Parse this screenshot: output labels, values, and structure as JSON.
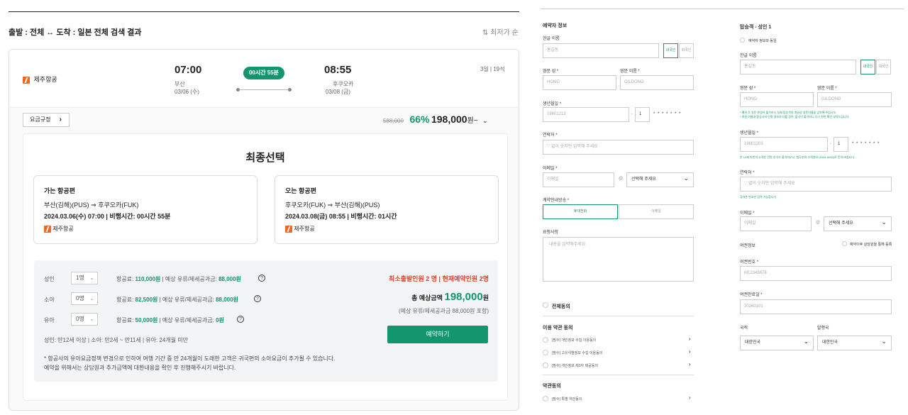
{
  "header": {
    "title": "출발 : 전체 ↔ 도착 : 일본 전체 검색 결과",
    "sort_label": "최저가 순"
  },
  "flight": {
    "airline": "제주항공",
    "dep_time": "07:00",
    "dep_city": "부산",
    "dep_date": "03/06 (수)",
    "duration": "00시간 55분",
    "arr_time": "08:55",
    "arr_city": "후쿠오카",
    "arr_date": "03/08 (금)",
    "trip_length": "3일 | 19석"
  },
  "fare": {
    "rules_label": "요금규정",
    "original_price": "588,000",
    "discount": "66%",
    "price": "198,000",
    "price_unit": "원~"
  },
  "final": {
    "title": "최종선택",
    "outbound": {
      "heading": "가는 항공편",
      "route_from": "부산(김해)(PUS)",
      "route_to": "후쿠오카(FUK)",
      "date_time": "2024.03.06(수) 07:00",
      "flight_time": "비행시간: 00시간 55분",
      "airline": "제주항공"
    },
    "inbound": {
      "heading": "오는 항공편",
      "route_from": "후쿠오카(FUK)",
      "route_to": "부산(김해)(PUS)",
      "date_time": "2024.03.08(금) 08:55",
      "flight_time": "비행시간: 01시간",
      "airline": "제주항공"
    }
  },
  "passengers": {
    "rows": [
      {
        "type": "성인",
        "count": "1명",
        "fare_label": "항공료:",
        "fare": "110,000원",
        "tax_label": "| 예상 유류/제세공과금:",
        "tax": "88,000원"
      },
      {
        "type": "소아",
        "count": "0명",
        "fare_label": "항공료:",
        "fare": "82,500원",
        "tax_label": "| 예상 유류/제세공과금:",
        "tax": "88,000원"
      },
      {
        "type": "유아",
        "count": "0명",
        "fare_label": "항공료:",
        "fare": "50,000원",
        "tax_label": "| 예상 유류/제세공과금:",
        "tax": "0원"
      }
    ],
    "age_note": "성인: 만12세 이상 | 소아: 만2세 ~ 만11세 | 유아: 24개월 미만",
    "min_notice": "최소출발인원 2 명 | 현재예약인원 2명",
    "total_label": "총 예상금액",
    "total": "198,000",
    "total_unit": "원",
    "total_note": "(예상 유류/제세공과금 88,000원 포함)",
    "book_button": "예약하기",
    "footnote1": "* 항공사의 유아요금정책 변경으로 인하여 여행 기간 중 만 24개월이 도래한 고객은 귀국편의 소아요금이 추가될 수 있습니다.",
    "footnote2": "예약을 위해서는 상담원과 추가금액에 대한내용을 확인 후 진행해주시기 바랍니다."
  },
  "booker": {
    "title": "예약자 정보",
    "name_label": "한글 이름",
    "name_ph": "홍길동",
    "domestic": "내국인",
    "foreign": "외국인",
    "last_label": "영문 성 *",
    "last_ph": "HONG",
    "first_label": "영문 이름 *",
    "first_ph": "GILDONG",
    "birth_label": "생년월일 *",
    "birth_ph": "19801212",
    "gender": "1",
    "mask": "* * * * * * *",
    "phone_label": "연락처 *",
    "phone_ph": "'-' 없이 숫자만 입력해 주세요",
    "email_label": "이메일 *",
    "email_ph": "이메일",
    "at": "@",
    "domain": "선택해 주세요",
    "contact_label": "계약안내방송 *",
    "contact_phone": "휴대전화",
    "contact_email": "이메일",
    "request_label": "요청사항",
    "request_ph": "내용을 입력해주세요",
    "agree_all": "전체동의",
    "terms_title": "이용 약관 동의",
    "terms": [
      "[필수] 개인정보 수집 이용동의",
      "[필수] 고유식별정보 수집 이용동의",
      "[필수] 개인정보 제3자 제공동의"
    ],
    "terms2_title": "약관동의",
    "terms2": [
      "[필수] 특별 약관동의"
    ]
  },
  "passenger1": {
    "title": "탑승객 - 성인 1",
    "same_as_booker": "예약자 정보와 동일",
    "name_label": "한글 이름",
    "name_ph": "홍길동",
    "domestic": "내국인",
    "foreign": "외국인",
    "last_label": "영문 성 *",
    "last_ph": "HONG",
    "first_label": "영문 이름 *",
    "first_ph": "GILDONG",
    "eng_hint1": "* 예약 후 영문 변경이 불가하니 실제 탑승객의 여권상 영문이름을 입력해 주십시오.",
    "eng_hint2": "* 여권 이름과 항공사의 인명 정보가 다를 경우, 출국이 불가하니 다시 한번 확인 부탁드립니다.",
    "birth_label": "생년월일 *",
    "birth_ph": "19801203",
    "gender": "1",
    "mask": "* * * * * * *",
    "birth_hint": "만 14세 미만의 고객은 인원 추가가 불가하오니, 법무부의 고객센터 (1544-5252)로 문의 바랍니다.",
    "phone_label": "연락처 *",
    "phone_ph": "'-' 없이 숫자만 입력해 주세요",
    "phone_hint": "휴대폰 번호만 입력 가능합니다.",
    "email_label": "이메일 *",
    "email_ph": "이메일",
    "at": "@",
    "domain": "선택해 주세요",
    "passport_title": "여권정보",
    "passport_consult": "예약이후 상담원을 통해 등록",
    "passport_no_label": "여권번호 *",
    "passport_no_ph": "M12345678",
    "passport_exp_label": "여권만료일 *",
    "passport_exp_ph": "20260101",
    "nationality_label": "국적",
    "nationality": "대한민국",
    "issuer_label": "발행국",
    "issuer": "대한민국"
  },
  "colors": {
    "accent": "#13966b",
    "red": "#d9412b",
    "airline": "#f26522"
  }
}
